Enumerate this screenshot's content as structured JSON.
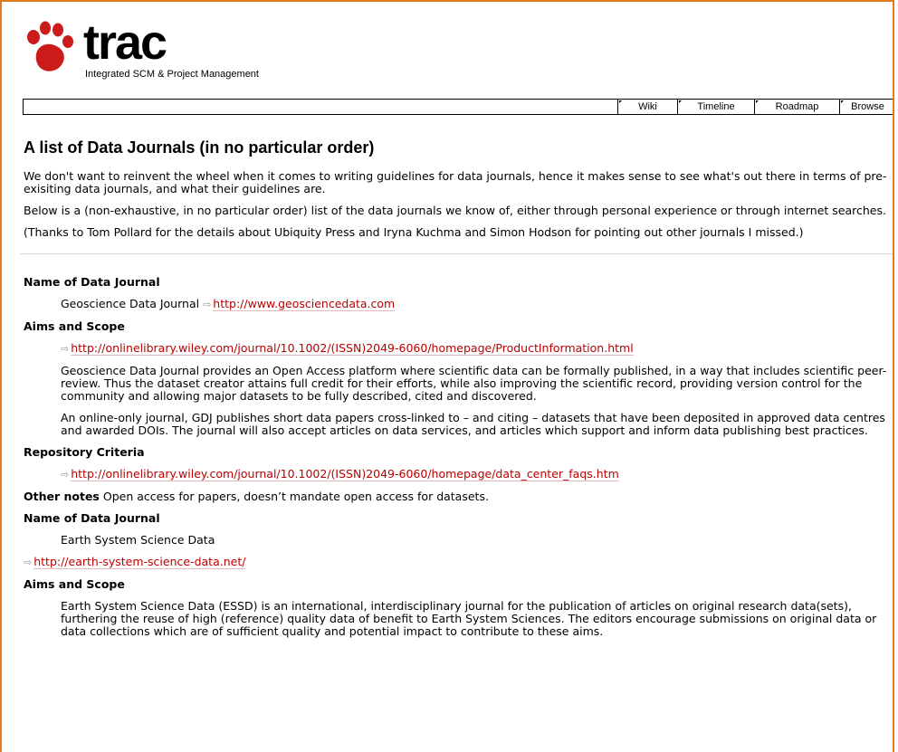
{
  "app": {
    "name": "trac",
    "tagline": "Integrated SCM & Project Management"
  },
  "nav": {
    "items": [
      {
        "label": "Wiki"
      },
      {
        "label": "Timeline"
      },
      {
        "label": "Roadmap"
      },
      {
        "label": "Browse"
      }
    ]
  },
  "page": {
    "title": "A list of Data Journals (in no particular order)",
    "intro": [
      "We don't want to reinvent the wheel when it comes to writing guidelines for data journals, hence it makes sense to see what's out there in terms of pre-exisiting data journals, and what their guidelines are.",
      "Below is a (non-exhaustive, in no particular order) list of the data journals we know of, either through personal experience or through internet searches.",
      "(Thanks to Tom Pollard for the details about Ubiquity Press and Iryna Kuchma and Simon Hodson for pointing out other journals I missed.)"
    ],
    "gdj": {
      "name_heading": "Name of Data Journal",
      "name": "Geoscience Data Journal",
      "name_link": "http://www.geosciencedata.com",
      "aims_heading": "Aims and Scope",
      "aims_link": "http://onlinelibrary.wiley.com/journal/10.1002/(ISSN)2049-6060/homepage/ProductInformation.html",
      "aims_p1": "Geoscience Data Journal provides an Open Access platform where scientific data can be formally published, in a way that includes scientific peer-review. Thus the dataset creator attains full credit for their efforts, while also improving the scientific record, providing version control for the community and allowing major datasets to be fully described, cited and discovered.",
      "aims_p2": "An online-only journal, GDJ publishes short data papers cross-linked to – and citing – datasets that have been deposited in approved data centres and awarded DOIs. The journal will also accept articles on data services, and articles which support and inform data publishing best practices.",
      "repo_heading": "Repository Criteria",
      "repo_link": "http://onlinelibrary.wiley.com/journal/10.1002/(ISSN)2049-6060/homepage/data_center_faqs.htm",
      "other_label": "Other notes",
      "other_text": "Open access for papers, doesn’t mandate open access for datasets."
    },
    "essd": {
      "name_heading": "Name of Data Journal",
      "name": "Earth System Science Data",
      "link": "http://earth-system-science-data.net/",
      "aims_heading": "Aims and Scope",
      "aims_p1": "Earth System Science Data (ESSD) is an international, interdisciplinary journal for the publication of articles on original research data(sets), furthering the reuse of high (reference) quality data of benefit to Earth System Sciences. The editors encourage submissions on original data or data collections which are of sufficient quality and potential impact to contribute to these aims."
    },
    "external_link_icon": "⇨"
  },
  "colors": {
    "frame_border": "#e07b1a",
    "link": "#bb0000",
    "logo_paw": "#cc1b1b"
  }
}
